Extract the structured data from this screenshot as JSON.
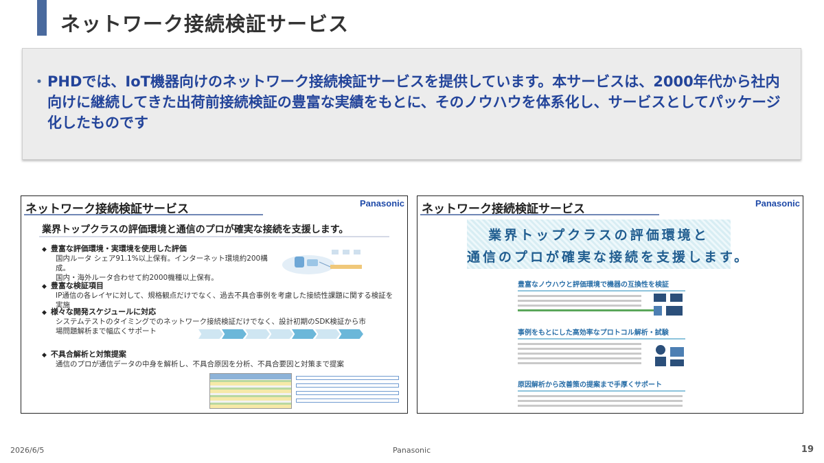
{
  "slide": {
    "title": "ネットワーク接続検証サービス",
    "bullet_glyph": "・",
    "description": "PHDでは、IoT機器向けのネットワーク接続検証サービスを提供しています。本サービスは、2000年代から社内向けに継続してきた出荷前接続検証の豊富な実績をもとに、そのノウハウを体系化し、サービスとしてパッケージ化したものです"
  },
  "left_thumbnail": {
    "title": "ネットワーク接続検証サービス",
    "logo": "Panasonic",
    "subtitle": "業界トップクラスの評価環境と通信のプロが確実な接続を支援します。",
    "items": [
      {
        "head": "豊富な評価環境・実環境を使用した評価",
        "body": "国内ルータ シェア91.1%以上保有。インターネット環境約200構成。\n国内・海外ルータ合わせて約2000機種以上保有。"
      },
      {
        "head": "豊富な検証項目",
        "body": "IP通信の各レイヤに対して、規格観点だけでなく、過去不具合事例を考慮した接続性課題に関する検証を実施"
      },
      {
        "head": "様々な開発スケジュールに対応",
        "body": "システムテストのタイミングでのネットワーク接続検証だけでなく、設計初期のSDK検証から市場問題解析まで幅広くサポート"
      },
      {
        "head": "不具合解析と対策提案",
        "body": "通信のプロが通信データの中身を解析し、不具合原因を分析、不具合要因と対策まで提案"
      }
    ]
  },
  "right_thumbnail": {
    "title": "ネットワーク接続検証サービス",
    "logo": "Panasonic",
    "banner_line1": "業界トップクラスの評価環境と",
    "banner_line2": "通信のプロが確実な接続を支援します。",
    "sections": [
      {
        "head": "豊富なノウハウと評価環境で機器の互換性を検証"
      },
      {
        "head": "事例をもとにした高効率なプロトコル解析・試験"
      },
      {
        "head": "原因解析から改善策の提案まで手厚くサポート"
      }
    ]
  },
  "footer": {
    "date": "2026/6/5",
    "brand": "Panasonic",
    "page": "19"
  }
}
